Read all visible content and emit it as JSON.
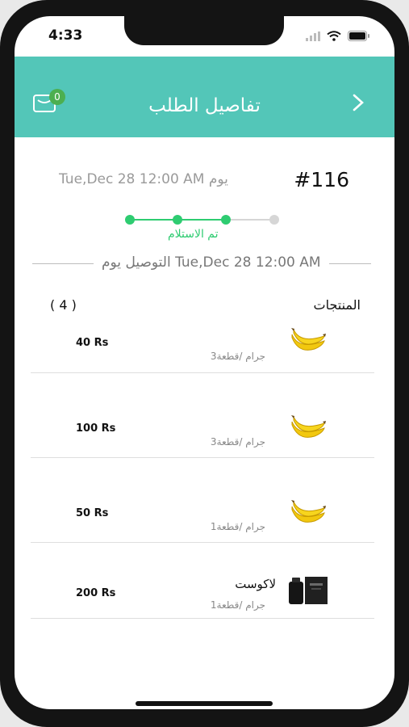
{
  "status_bar": {
    "time": "4:33"
  },
  "header": {
    "title": "تفاصيل الطلب",
    "cart_count": "0"
  },
  "order": {
    "number": "#116",
    "date": "Tue,Dec 28 12:00 AM  يوم"
  },
  "progress": {
    "steps_total": 4,
    "steps_done": 3,
    "status_label": "تم الاستلام",
    "active_color": "#2ecc71",
    "inactive_color": "#d6d6d6"
  },
  "delivery": {
    "text": "التوصيل يوم  Tue,Dec 28 12:00 AM"
  },
  "products": {
    "title": "المنتجات",
    "count": "( 4 )",
    "items": [
      {
        "name": "",
        "unit": "جرام /قطعة3",
        "price": "40 Rs",
        "icon": "banana-icon"
      },
      {
        "name": "",
        "unit": "جرام /قطعة3",
        "price": "100 Rs",
        "icon": "banana-icon"
      },
      {
        "name": "",
        "unit": "جرام /قطعة1",
        "price": "50 Rs",
        "icon": "banana-icon"
      },
      {
        "name": "لاكوست",
        "unit": "جرام /قطعة1",
        "price": "200 Rs",
        "icon": "perfume-icon"
      }
    ]
  },
  "colors": {
    "header": "#53c6b8",
    "badge": "#4caf50"
  }
}
